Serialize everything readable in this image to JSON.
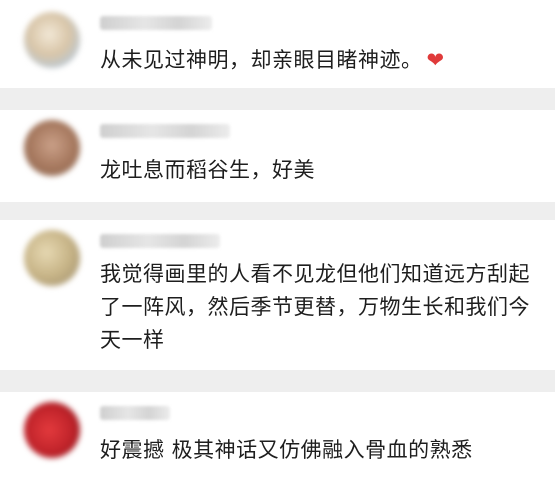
{
  "comments": [
    {
      "avatar_color": "#d7cfc0",
      "text": "从未见过神明，却亲眼目睹神迹。",
      "icon": "heart-icon",
      "heart": "❤"
    },
    {
      "avatar_color": "#b48a6e",
      "text": "龙吐息而稻谷生，好美"
    },
    {
      "avatar_color": "#cdbf95",
      "text": "我觉得画里的人看不见龙但他们知道远方刮起了一阵风，然后季节更替，万物生长和我们今天一样"
    },
    {
      "avatar_color": "#c5262c",
      "text": "好震撼 极其神话又仿佛融入骨血的熟悉"
    }
  ]
}
